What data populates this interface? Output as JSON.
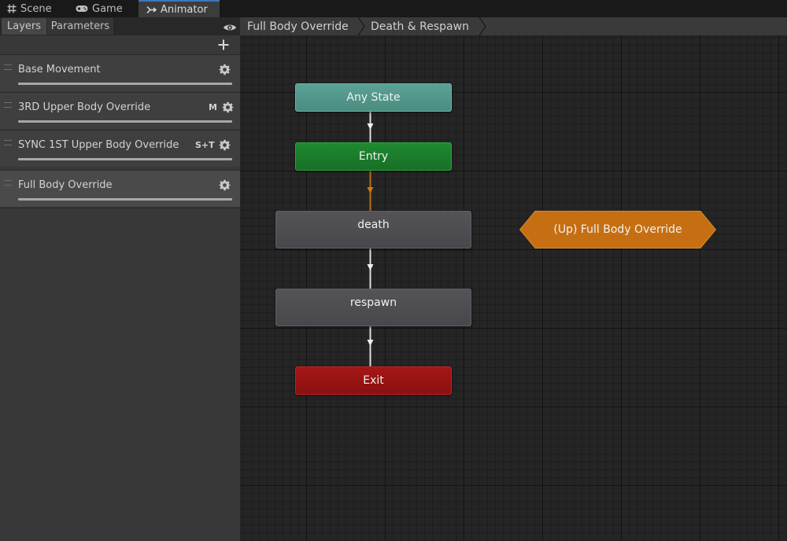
{
  "tabs": [
    {
      "label": "Scene",
      "icon": "grid-icon"
    },
    {
      "label": "Game",
      "icon": "gamepad-icon"
    },
    {
      "label": "Animator",
      "icon": "animator-icon",
      "active": true
    }
  ],
  "left_panel": {
    "subtabs": {
      "layers": "Layers",
      "parameters": "Parameters"
    },
    "layers": [
      {
        "name": "Base Movement",
        "badge": ""
      },
      {
        "name": "3RD Upper Body Override",
        "badge": "M"
      },
      {
        "name": "SYNC 1ST Upper Body Override",
        "badge": "S+T"
      },
      {
        "name": "Full Body Override",
        "badge": "",
        "selected": true
      }
    ]
  },
  "breadcrumbs": [
    "Full Body Override",
    "Death & Respawn"
  ],
  "graph": {
    "nodes": {
      "any_state": "Any State",
      "entry": "Entry",
      "death": "death",
      "respawn": "respawn",
      "exit": "Exit",
      "up_state_machine": "(Up) Full Body Override"
    }
  },
  "colors": {
    "any_state": "#4f9488",
    "entry": "#1b7c2c",
    "state": "#4d4d51",
    "exit": "#971313",
    "up_state_machine": "#c66f12",
    "active_tab_accent": "#3a79bb",
    "default_transition": "#b87412"
  }
}
